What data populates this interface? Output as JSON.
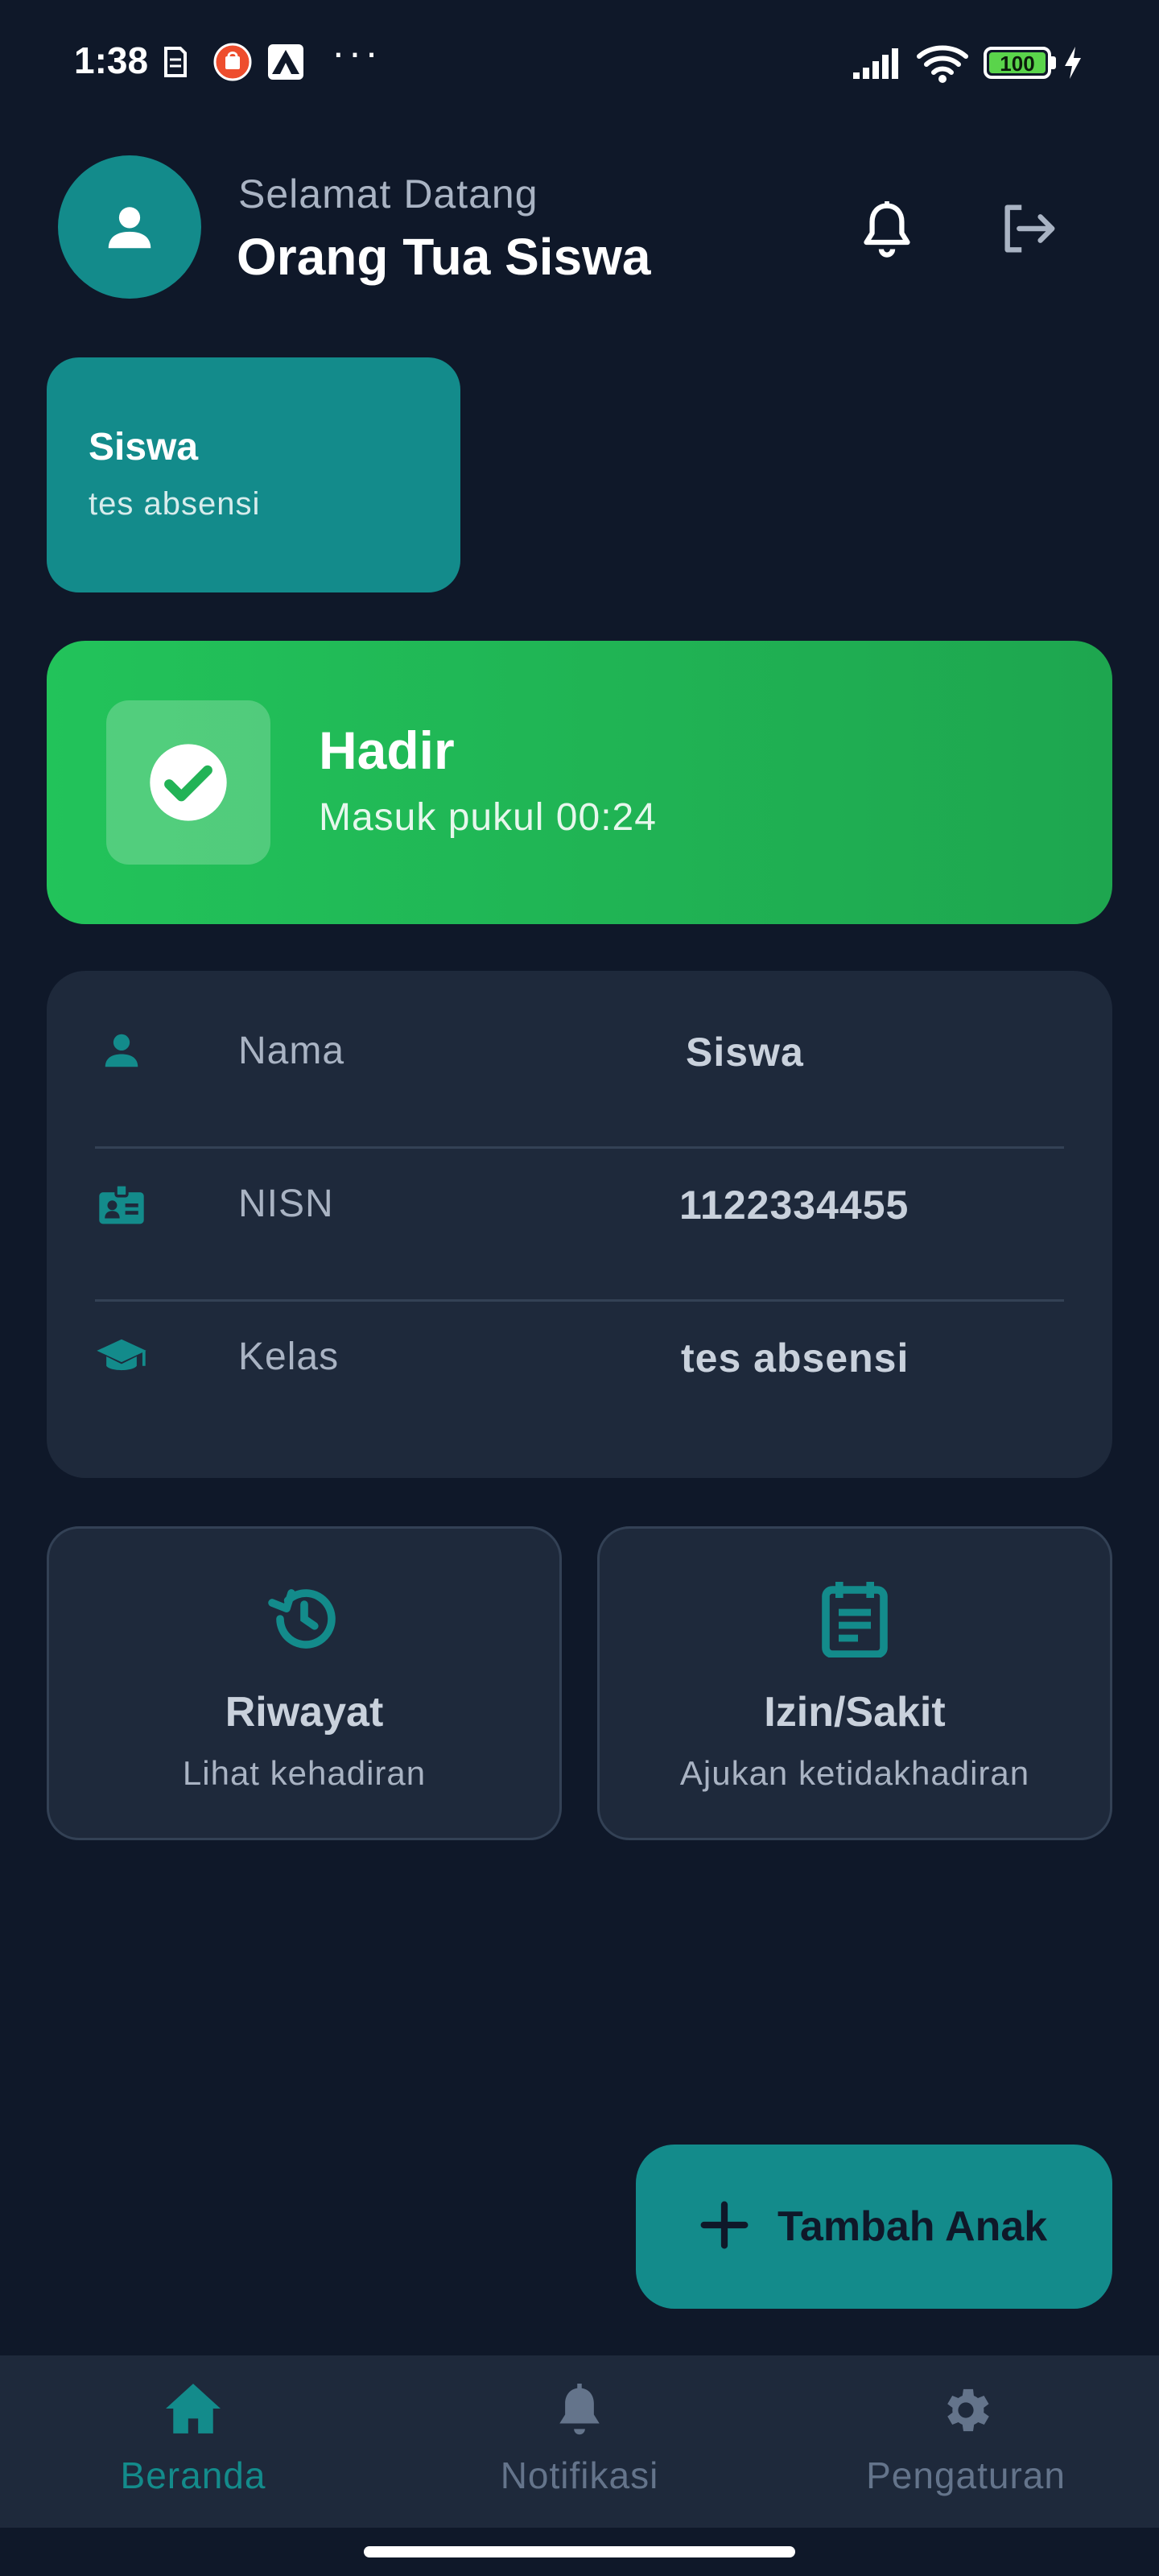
{
  "status_bar": {
    "time": "1:38",
    "dots": "···",
    "battery": "100"
  },
  "header": {
    "greeting": "Selamat Datang",
    "user_name": "Orang Tua Siswa"
  },
  "child": {
    "name": "Siswa",
    "class": "tes absensi"
  },
  "attendance": {
    "status": "Hadir",
    "detail": "Masuk pukul 00:24"
  },
  "info": {
    "rows": [
      {
        "label": "Nama",
        "value": "Siswa",
        "icon": "person-icon"
      },
      {
        "label": "NISN",
        "value": "1122334455",
        "icon": "id-badge-icon"
      },
      {
        "label": "Kelas",
        "value": "tes absensi",
        "icon": "graduation-cap-icon"
      }
    ]
  },
  "actions": {
    "history": {
      "title": "Riwayat",
      "subtitle": "Lihat kehadiran",
      "icon": "history-icon"
    },
    "leave": {
      "title": "Izin/Sakit",
      "subtitle": "Ajukan ketidakhadiran",
      "icon": "document-icon"
    }
  },
  "fab": {
    "label": "Tambah Anak",
    "icon": "plus-icon"
  },
  "bottom_nav": {
    "items": [
      {
        "label": "Beranda",
        "icon": "home-icon",
        "active": true
      },
      {
        "label": "Notifikasi",
        "icon": "bell-icon",
        "active": false
      },
      {
        "label": "Pengaturan",
        "icon": "gear-icon",
        "active": false
      }
    ]
  },
  "colors": {
    "background": "#0f1829",
    "accent": "#138b8b",
    "success": "#22c35a",
    "card": "#1e293b",
    "inactive_nav": "#64748b"
  }
}
